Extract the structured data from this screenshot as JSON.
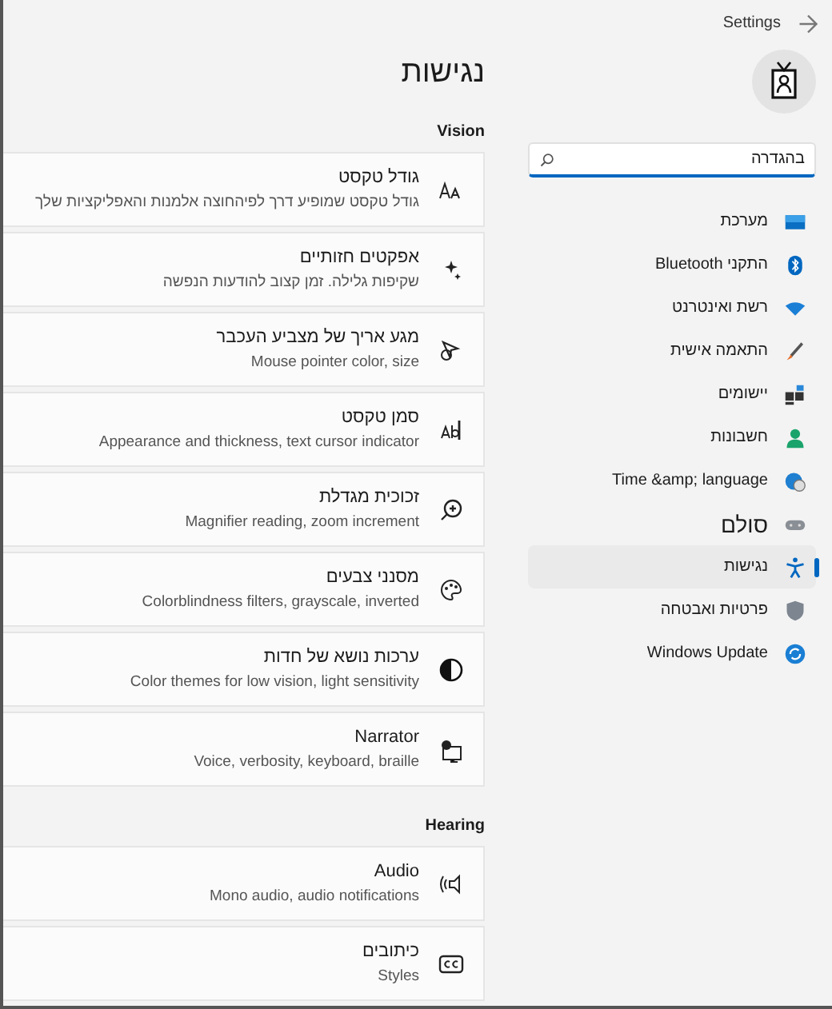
{
  "window": {
    "title": "Settings"
  },
  "search": {
    "value": "בהגדרה"
  },
  "sidebar": {
    "items": [
      {
        "label": "מערכת",
        "selected": false,
        "kind": "item"
      },
      {
        "label": "התקני Bluetooth",
        "selected": false,
        "kind": "item"
      },
      {
        "label": "רשת ואינטרנט",
        "selected": false,
        "kind": "item"
      },
      {
        "label": "התאמה אישית",
        "selected": false,
        "kind": "item"
      },
      {
        "label": "יישומים",
        "selected": false,
        "kind": "item"
      },
      {
        "label": "חשבונות",
        "selected": false,
        "kind": "item"
      },
      {
        "label": "Time &amp; language",
        "selected": false,
        "kind": "item"
      },
      {
        "label": "סולם",
        "selected": false,
        "kind": "large"
      },
      {
        "label": "נגישות",
        "selected": true,
        "kind": "item"
      },
      {
        "label": "פרטיות ואבטחה",
        "selected": false,
        "kind": "item"
      },
      {
        "label": "Windows Update",
        "selected": false,
        "kind": "item"
      }
    ]
  },
  "page": {
    "title": "נגישות",
    "sections": [
      {
        "title": "Vision",
        "cards": [
          {
            "title": "גודל טקסט",
            "description": "גודל טקסט שמופיע דרך לפיהחוצה אלמנות והאפליקציות שלך"
          },
          {
            "title": "אפקטים חזותיים",
            "description": "שקיפות גלילה. זמן קצוב להודעות הנפשה"
          },
          {
            "title": "מגע אריך של מצביע העכבר",
            "description": "Mouse pointer color, size"
          },
          {
            "title": "סמן טקסט",
            "description": "Appearance and thickness, text cursor indicator"
          },
          {
            "title": "זכוכית מגדלת",
            "description": "Magnifier reading, zoom increment"
          },
          {
            "title": "מסנני צבעים",
            "description": "Colorblindness filters, grayscale, inverted"
          },
          {
            "title": "ערכות נושא של חדות",
            "description": "Color themes for low vision, light sensitivity"
          },
          {
            "title": "Narrator",
            "description": "Voice, verbosity, keyboard, braille"
          }
        ]
      },
      {
        "title": "Hearing",
        "cards": [
          {
            "title": "Audio",
            "description": "Mono audio, audio notifications"
          },
          {
            "title": "כיתובים",
            "description": "Styles"
          }
        ]
      }
    ]
  }
}
